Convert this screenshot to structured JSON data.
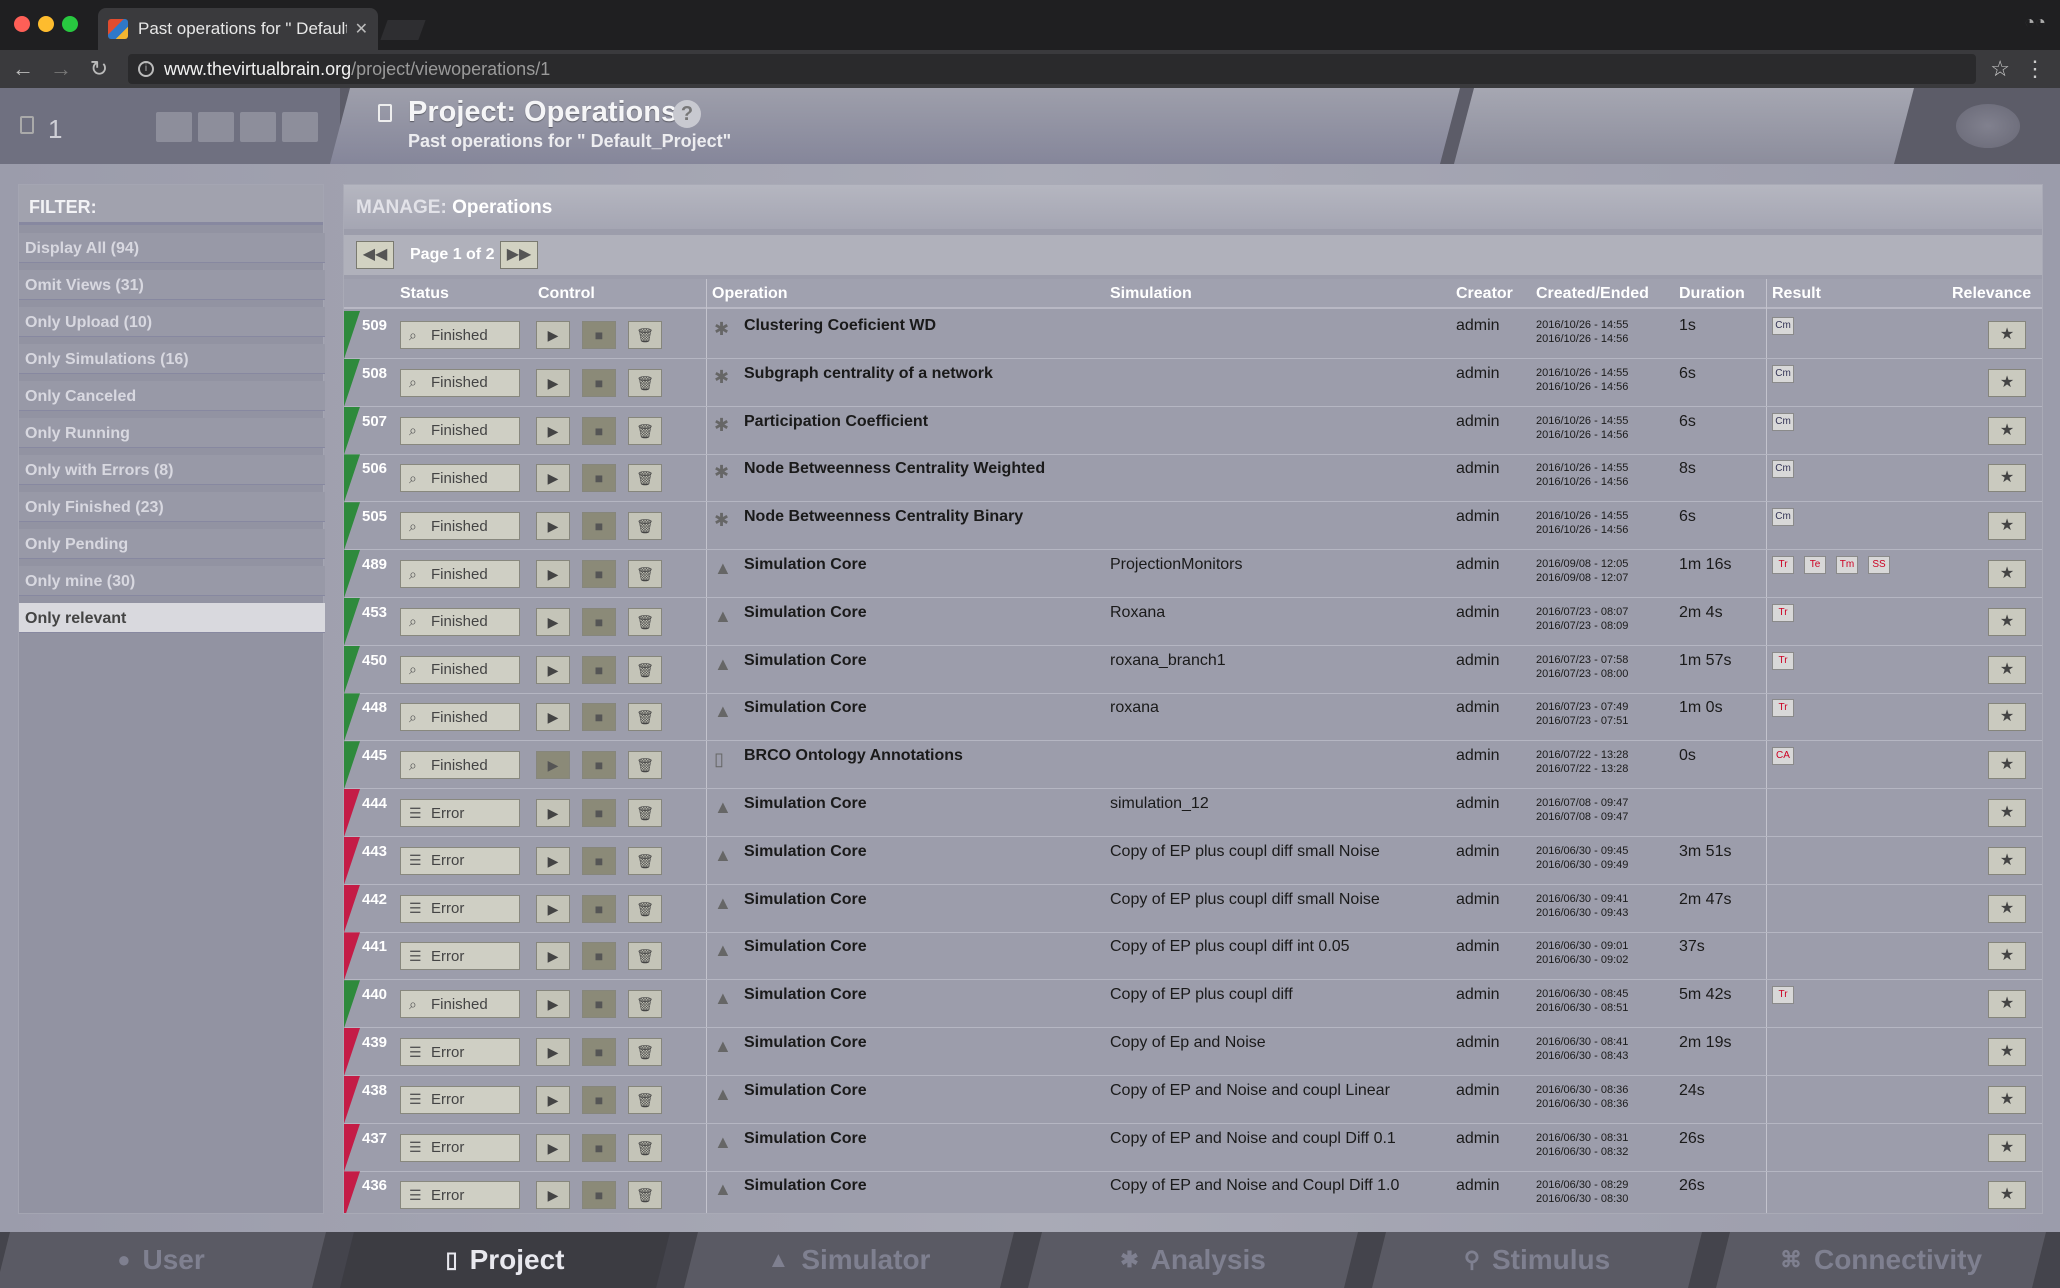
{
  "browser": {
    "tab_title": "Past operations for \" Default_P",
    "url_host": "www.thevirtualbrain.org",
    "url_path": "/project/viewoperations/1"
  },
  "header": {
    "project_count": "1",
    "title": "Project: Operations",
    "subtitle": "Past operations for \" Default_Project\""
  },
  "filter": {
    "title": "FILTER:",
    "items": [
      {
        "label": "Display All (94)"
      },
      {
        "label": "Omit Views (31)"
      },
      {
        "label": "Only Upload (10)"
      },
      {
        "label": "Only Simulations (16)"
      },
      {
        "label": "Only Canceled"
      },
      {
        "label": "Only Running"
      },
      {
        "label": "Only with Errors (8)"
      },
      {
        "label": "Only Finished (23)"
      },
      {
        "label": "Only Pending"
      },
      {
        "label": "Only mine (30)"
      },
      {
        "label": "Only relevant",
        "selected": true
      }
    ]
  },
  "manage": {
    "label": "MANAGE:",
    "value": "Operations",
    "page_info": "Page 1 of 2"
  },
  "table": {
    "headers": {
      "status": "Status",
      "control": "Control",
      "operation": "Operation",
      "simulation": "Simulation",
      "creator": "Creator",
      "created": "Created/Ended",
      "duration": "Duration",
      "result": "Result",
      "relevance": "Relevance"
    },
    "rows": [
      {
        "id": "509",
        "status": "Finished",
        "kind": "analyzer",
        "operation": "Clustering Coeficient WD",
        "simulation": "",
        "creator": "admin",
        "created": "2016/10/26 - 14:55",
        "ended": "2016/10/26 - 14:56",
        "duration": "1s",
        "results": [
          "Cm"
        ]
      },
      {
        "id": "508",
        "status": "Finished",
        "kind": "analyzer",
        "operation": "Subgraph centrality of a network",
        "simulation": "",
        "creator": "admin",
        "created": "2016/10/26 - 14:55",
        "ended": "2016/10/26 - 14:56",
        "duration": "6s",
        "results": [
          "Cm"
        ]
      },
      {
        "id": "507",
        "status": "Finished",
        "kind": "analyzer",
        "operation": "Participation Coefficient",
        "simulation": "",
        "creator": "admin",
        "created": "2016/10/26 - 14:55",
        "ended": "2016/10/26 - 14:56",
        "duration": "6s",
        "results": [
          "Cm"
        ]
      },
      {
        "id": "506",
        "status": "Finished",
        "kind": "analyzer",
        "operation": "Node Betweenness Centrality Weighted",
        "simulation": "",
        "creator": "admin",
        "created": "2016/10/26 - 14:55",
        "ended": "2016/10/26 - 14:56",
        "duration": "8s",
        "results": [
          "Cm"
        ]
      },
      {
        "id": "505",
        "status": "Finished",
        "kind": "analyzer",
        "operation": "Node Betweenness Centrality Binary",
        "simulation": "",
        "creator": "admin",
        "created": "2016/10/26 - 14:55",
        "ended": "2016/10/26 - 14:56",
        "duration": "6s",
        "results": [
          "Cm"
        ]
      },
      {
        "id": "489",
        "status": "Finished",
        "kind": "simulator",
        "operation": "Simulation Core",
        "simulation": "ProjectionMonitors",
        "creator": "admin",
        "created": "2016/09/08 - 12:05",
        "ended": "2016/09/08 - 12:07",
        "duration": "1m 16s",
        "results": [
          "Tr",
          "Te",
          "Tm",
          "SS"
        ]
      },
      {
        "id": "453",
        "status": "Finished",
        "kind": "simulator",
        "operation": "Simulation Core",
        "simulation": "Roxana",
        "creator": "admin",
        "created": "2016/07/23 - 08:07",
        "ended": "2016/07/23 - 08:09",
        "duration": "2m 4s",
        "results": [
          "Tr"
        ]
      },
      {
        "id": "450",
        "status": "Finished",
        "kind": "simulator",
        "operation": "Simulation Core",
        "simulation": "roxana_branch1",
        "creator": "admin",
        "created": "2016/07/23 - 07:58",
        "ended": "2016/07/23 - 08:00",
        "duration": "1m 57s",
        "results": [
          "Tr"
        ]
      },
      {
        "id": "448",
        "status": "Finished",
        "kind": "simulator",
        "operation": "Simulation Core",
        "simulation": "roxana",
        "creator": "admin",
        "created": "2016/07/23 - 07:49",
        "ended": "2016/07/23 - 07:51",
        "duration": "1m 0s",
        "results": [
          "Tr"
        ]
      },
      {
        "id": "445",
        "status": "Finished",
        "kind": "upload",
        "operation": "BRCO Ontology Annotations",
        "simulation": "",
        "creator": "admin",
        "created": "2016/07/22 - 13:28",
        "ended": "2016/07/22 - 13:28",
        "duration": "0s",
        "results": [
          "CA"
        ]
      },
      {
        "id": "444",
        "status": "Error",
        "kind": "simulator",
        "operation": "Simulation Core",
        "simulation": "simulation_12",
        "creator": "admin",
        "created": "2016/07/08 - 09:47",
        "ended": "2016/07/08 - 09:47",
        "duration": "",
        "results": []
      },
      {
        "id": "443",
        "status": "Error",
        "kind": "simulator",
        "operation": "Simulation Core",
        "simulation": "Copy of EP plus coupl diff small Noise",
        "creator": "admin",
        "created": "2016/06/30 - 09:45",
        "ended": "2016/06/30 - 09:49",
        "duration": "3m 51s",
        "results": []
      },
      {
        "id": "442",
        "status": "Error",
        "kind": "simulator",
        "operation": "Simulation Core",
        "simulation": "Copy of EP plus coupl diff small Noise",
        "creator": "admin",
        "created": "2016/06/30 - 09:41",
        "ended": "2016/06/30 - 09:43",
        "duration": "2m 47s",
        "results": []
      },
      {
        "id": "441",
        "status": "Error",
        "kind": "simulator",
        "operation": "Simulation Core",
        "simulation": "Copy of EP plus coupl diff int 0.05",
        "creator": "admin",
        "created": "2016/06/30 - 09:01",
        "ended": "2016/06/30 - 09:02",
        "duration": "37s",
        "results": []
      },
      {
        "id": "440",
        "status": "Finished",
        "kind": "simulator",
        "operation": "Simulation Core",
        "simulation": "Copy of EP plus coupl diff",
        "creator": "admin",
        "created": "2016/06/30 - 08:45",
        "ended": "2016/06/30 - 08:51",
        "duration": "5m 42s",
        "results": [
          "Tr"
        ]
      },
      {
        "id": "439",
        "status": "Error",
        "kind": "simulator",
        "operation": "Simulation Core",
        "simulation": "Copy of Ep and Noise",
        "creator": "admin",
        "created": "2016/06/30 - 08:41",
        "ended": "2016/06/30 - 08:43",
        "duration": "2m 19s",
        "results": []
      },
      {
        "id": "438",
        "status": "Error",
        "kind": "simulator",
        "operation": "Simulation Core",
        "simulation": "Copy of EP and Noise and coupl Linear",
        "creator": "admin",
        "created": "2016/06/30 - 08:36",
        "ended": "2016/06/30 - 08:36",
        "duration": "24s",
        "results": []
      },
      {
        "id": "437",
        "status": "Error",
        "kind": "simulator",
        "operation": "Simulation Core",
        "simulation": "Copy of EP and Noise and coupl Diff 0.1",
        "creator": "admin",
        "created": "2016/06/30 - 08:31",
        "ended": "2016/06/30 - 08:32",
        "duration": "26s",
        "results": []
      },
      {
        "id": "436",
        "status": "Error",
        "kind": "simulator",
        "operation": "Simulation Core",
        "simulation": "Copy of EP and Noise and Coupl Diff 1.0",
        "creator": "admin",
        "created": "2016/06/30 - 08:29",
        "ended": "2016/06/30 - 08:30",
        "duration": "26s",
        "results": []
      }
    ]
  },
  "bottom_tabs": [
    {
      "label": "User",
      "icon": "user-icon"
    },
    {
      "label": "Project",
      "icon": "document-icon",
      "active": true
    },
    {
      "label": "Simulator",
      "icon": "rocket-icon"
    },
    {
      "label": "Analysis",
      "icon": "gear-icon"
    },
    {
      "label": "Stimulus",
      "icon": "pin-icon"
    },
    {
      "label": "Connectivity",
      "icon": "network-icon"
    }
  ]
}
